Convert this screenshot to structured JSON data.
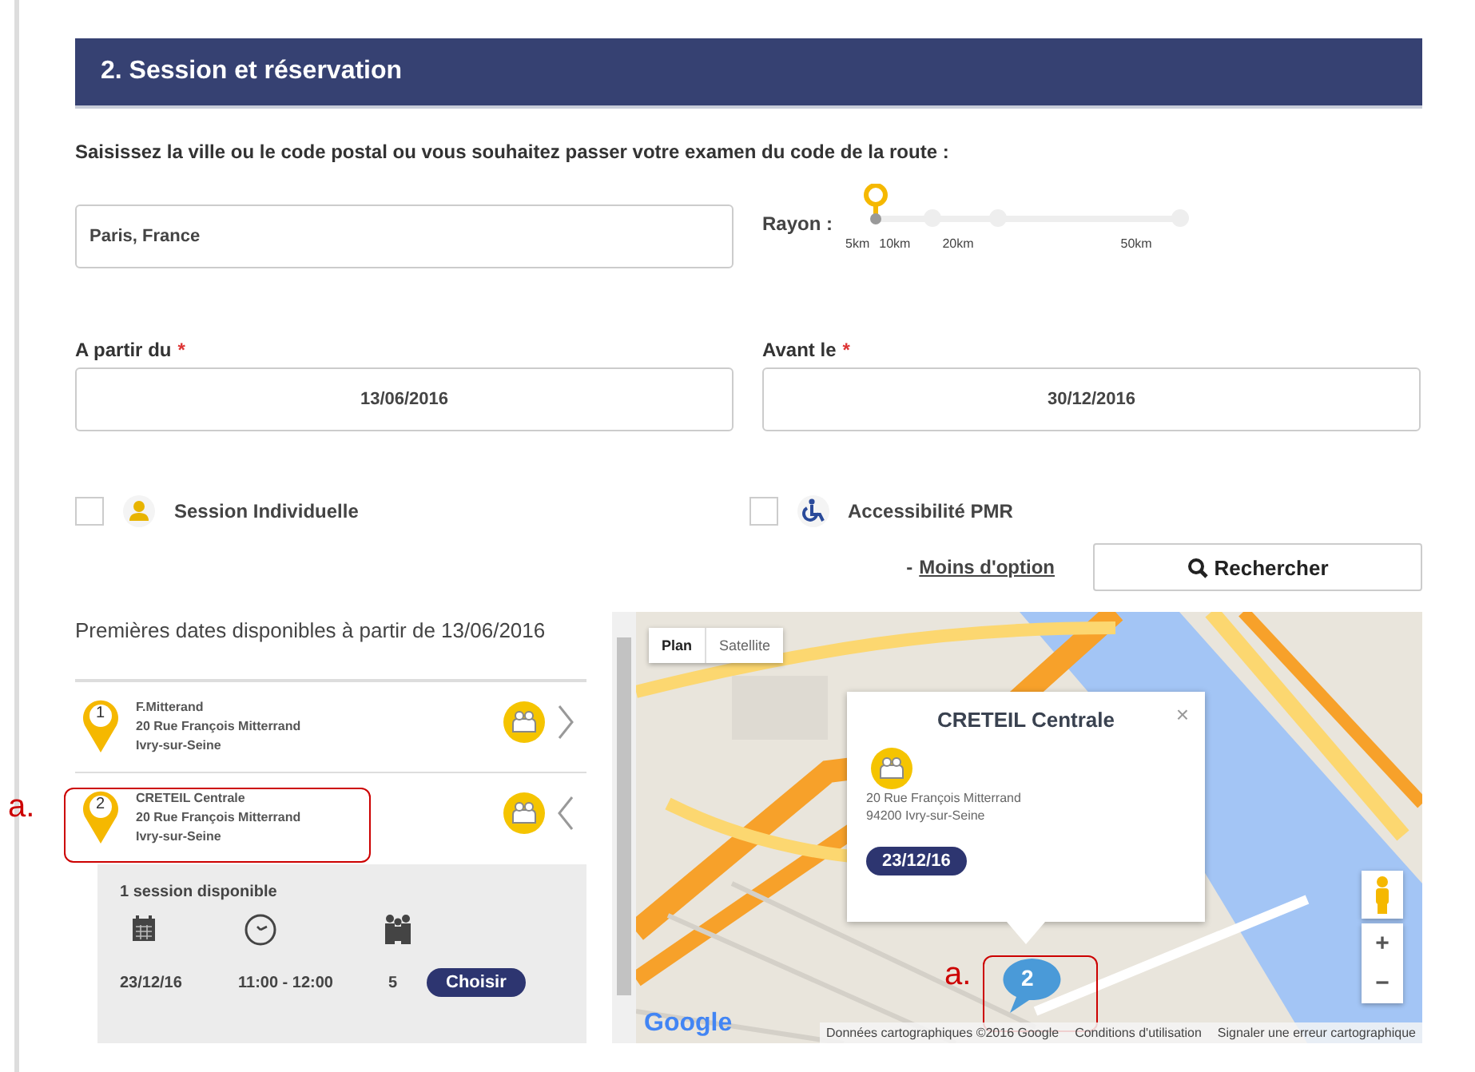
{
  "section": {
    "title": "2. Session et réservation"
  },
  "instruction": "Saisissez la ville ou le code postal ou vous souhaitez passer votre examen du code de la route :",
  "city_field": {
    "value": "Paris, France"
  },
  "radius": {
    "label": "Rayon :",
    "level": 0,
    "ticks": [
      "5km",
      "10km",
      "20km",
      "50km"
    ]
  },
  "dates": [
    {
      "label": "A partir du",
      "required_mark": "*",
      "value": "13/06/2016"
    },
    {
      "label": "Avant le",
      "required_mark": "*",
      "value": "30/12/2016"
    }
  ],
  "options": [
    {
      "kind": "individual",
      "label": "Session Individuelle",
      "checked": false
    },
    {
      "kind": "accessibility",
      "label": "Accessibilité PMR",
      "checked": false
    }
  ],
  "less_options": {
    "prefix": "-",
    "link": "Moins d'option"
  },
  "search_button": "Rechercher",
  "results": {
    "heading": "Premières dates disponibles à partir de 13/06/2016",
    "centers": [
      {
        "number": "1",
        "name": "F.Mitterand",
        "address": "20 Rue François Mitterrand",
        "city": "Ivry-sur-Seine",
        "expanded": false
      },
      {
        "number": "2",
        "name": "CRETEIL Centrale",
        "address": "20 Rue François Mitterrand",
        "city": "Ivry-sur-Seine",
        "expanded": true,
        "annotation": "a.",
        "sessions": {
          "count": "1 session disponible",
          "rows": [
            {
              "date": "23/12/16",
              "time": "11:00 - 12:00",
              "seats": "5",
              "button": "Choisir"
            }
          ]
        }
      }
    ]
  },
  "map": {
    "types": [
      {
        "label": "Plan",
        "selected": true
      },
      {
        "label": "Satellite",
        "selected": false
      }
    ],
    "popup": {
      "title": "CRETEIL Centrale",
      "address": "20 Rue François Mitterrand",
      "city": "94200 Ivry-sur-Seine",
      "date": "23/12/16",
      "close": "×"
    },
    "marker": {
      "number": "2",
      "annotation": "a."
    },
    "zoom": [
      "+",
      "−"
    ],
    "logo": "Google",
    "attribution": [
      "Données cartographiques ©2016 Google",
      "Conditions d'utilisation",
      "Signaler une erreur cartographique"
    ]
  }
}
